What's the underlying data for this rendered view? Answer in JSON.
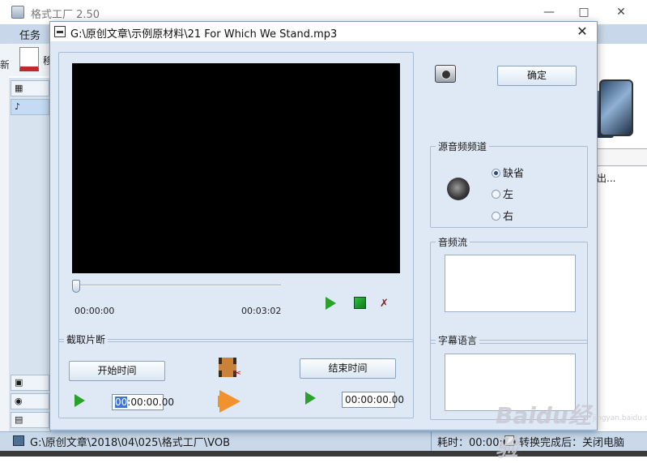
{
  "main_window": {
    "title": "格式工厂 2.50",
    "menu_task": "任务",
    "left_edge_char": "新",
    "toolbar_partial": "移",
    "right_partial": "出...",
    "status_path": "G:\\原创文章\\2018\\04\\025\\格式工厂\\VOB",
    "status_elapsed": "耗时：00:00:00",
    "status_after": "转换完成后：关闭电脑"
  },
  "dialog": {
    "title": "G:\\原创文章\\示例原材料\\21 For Which We Stand.mp3",
    "ok_label": "确定",
    "start_time_display": "00:00:00",
    "end_time_display": "00:03:02",
    "clip": {
      "group_label": "截取片断",
      "start_button": "开始时间",
      "end_button": "结束时间",
      "start_value": "00:00:00.00",
      "start_value_head": "00",
      "start_value_tail": ":00:00.00",
      "end_value": "00:00:00.00"
    },
    "source_channel": {
      "group_label": "源音频频道",
      "options": [
        "缺省",
        "左",
        "右"
      ],
      "selected": "缺省"
    },
    "audio_stream_label": "音频流",
    "subtitle_language_label": "字幕语言"
  },
  "watermark": {
    "text": "Baidu经验",
    "sub": "jingyan.baidu.com"
  },
  "colors": {
    "dialog_bg": "#dfe9f5",
    "menubar": "#c8d8ea",
    "play_green": "#2aa12a"
  }
}
